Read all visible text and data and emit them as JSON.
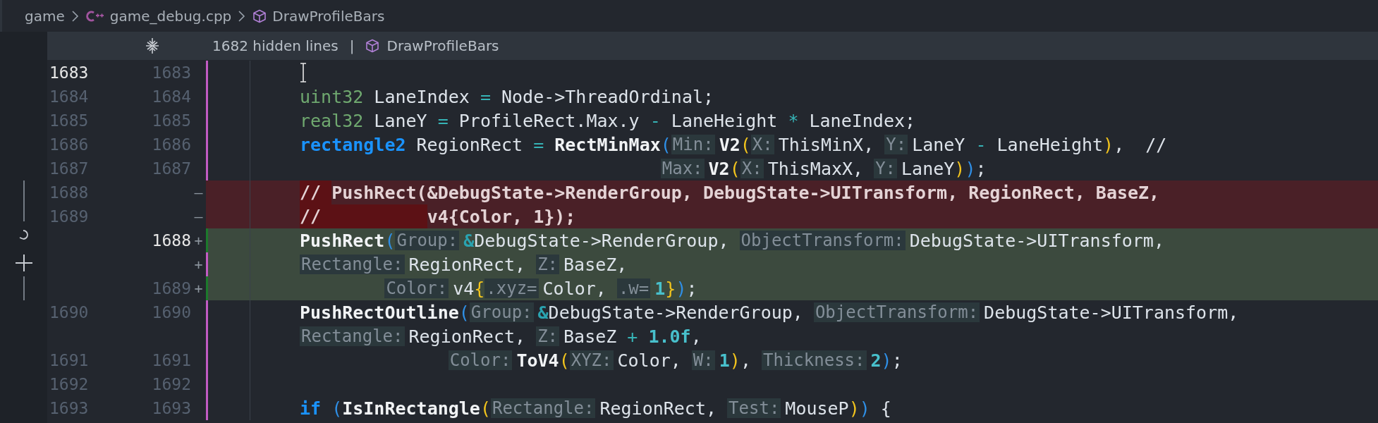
{
  "breadcrumb": [
    {
      "kind": "folder",
      "label": "game"
    },
    {
      "kind": "cpp-file",
      "label": "game_debug.cpp"
    },
    {
      "kind": "symbol",
      "label": "DrawProfileBars"
    }
  ],
  "sticky_header": {
    "hidden_lines": "1682 hidden lines",
    "separator": "|",
    "symbol": "DrawProfileBars"
  },
  "lines": [
    {
      "old": "1683",
      "new": "1683",
      "active": true,
      "kind": "unchanged"
    },
    {
      "old": "1684",
      "new": "1684",
      "active": false,
      "kind": "unchanged",
      "tokens": [
        {
          "kind": "type",
          "text": "uint32"
        },
        {
          "kind": "plain",
          "text": " LaneIndex "
        },
        {
          "kind": "op",
          "text": "="
        },
        {
          "kind": "plain",
          "text": " Node->ThreadOrdinal;"
        }
      ]
    },
    {
      "old": "1685",
      "new": "1685",
      "active": false,
      "kind": "unchanged",
      "tokens": [
        {
          "kind": "type",
          "text": "real32"
        },
        {
          "kind": "plain",
          "text": " LaneY "
        },
        {
          "kind": "op",
          "text": "="
        },
        {
          "kind": "plain",
          "text": " ProfileRect.Max.y "
        },
        {
          "kind": "op",
          "text": "-"
        },
        {
          "kind": "plain",
          "text": " LaneHeight "
        },
        {
          "kind": "op",
          "text": "*"
        },
        {
          "kind": "plain",
          "text": " LaneIndex;"
        }
      ]
    },
    {
      "old": "1686",
      "new": "1686",
      "active": false,
      "kind": "unchanged",
      "tokens": [
        {
          "kind": "keyword",
          "text": "rectangle2"
        },
        {
          "kind": "plain",
          "text": " RegionRect "
        },
        {
          "kind": "op",
          "text": "="
        },
        {
          "kind": "function",
          "text": " RectMinMax"
        },
        {
          "kind": "paren1",
          "text": "("
        },
        {
          "kind": "hint",
          "text": "Min:"
        },
        {
          "kind": "function",
          "text": "V2"
        },
        {
          "kind": "paren2",
          "text": "("
        },
        {
          "kind": "hint",
          "text": "X:"
        },
        {
          "kind": "plain",
          "text": "ThisMinX, "
        },
        {
          "kind": "hint",
          "text": "Y:"
        },
        {
          "kind": "plain",
          "text": "LaneY "
        },
        {
          "kind": "op",
          "text": "-"
        },
        {
          "kind": "plain",
          "text": " LaneHeight"
        },
        {
          "kind": "paren2",
          "text": ")"
        },
        {
          "kind": "plain",
          "text": ",  //"
        }
      ]
    },
    {
      "old": "1687",
      "new": "1687",
      "active": false,
      "kind": "unchanged",
      "tokens": [
        {
          "kind": "hint",
          "text": "                                  Max:"
        },
        {
          "kind": "function",
          "text": "V2"
        },
        {
          "kind": "paren2",
          "text": "("
        },
        {
          "kind": "hint",
          "text": "X:"
        },
        {
          "kind": "plain",
          "text": "ThisMaxX, "
        },
        {
          "kind": "hint",
          "text": "Y:"
        },
        {
          "kind": "plain",
          "text": "LaneY"
        },
        {
          "kind": "paren2",
          "text": ")"
        },
        {
          "kind": "paren1",
          "text": ")"
        },
        {
          "kind": "plain",
          "text": ";"
        }
      ]
    },
    {
      "old": "1688",
      "marker": "—",
      "active": false,
      "kind": "removed",
      "tokens": [
        {
          "kind": "deleted",
          "text": "// "
        },
        {
          "kind": "plain",
          "text": "PushRect(&DebugState->RenderGroup, DebugState->UITransform, RegionRect, BaseZ,"
        }
      ]
    },
    {
      "old": "1689",
      "marker": "—",
      "active": false,
      "kind": "removed",
      "tokens": [
        {
          "kind": "deleted",
          "text": "//          "
        },
        {
          "kind": "plain",
          "text": "v4{Color, 1});"
        }
      ]
    },
    {
      "new": "1688",
      "marker": "+",
      "active": true,
      "kind": "added",
      "tokens": [
        {
          "kind": "function",
          "text": "PushRect"
        },
        {
          "kind": "paren1",
          "text": "("
        },
        {
          "kind": "hint",
          "text": "Group:"
        },
        {
          "kind": "amp",
          "text": "&"
        },
        {
          "kind": "plain",
          "text": "DebugState->RenderGroup, "
        },
        {
          "kind": "hint",
          "text": "ObjectTransform:"
        },
        {
          "kind": "plain",
          "text": "DebugState->UITransform,"
        }
      ]
    },
    {
      "marker": "+",
      "kind": "added",
      "tokens": [
        {
          "kind": "hint",
          "text": "Rectangle:"
        },
        {
          "kind": "plain",
          "text": "RegionRect, "
        },
        {
          "kind": "hint",
          "text": "Z:"
        },
        {
          "kind": "plain",
          "text": "BaseZ,"
        }
      ]
    },
    {
      "new": "1689",
      "marker": "+",
      "active": false,
      "kind": "added",
      "tokens": [
        {
          "kind": "hint",
          "text": "        Color:"
        },
        {
          "kind": "plain",
          "text": "v4"
        },
        {
          "kind": "paren2",
          "text": "{"
        },
        {
          "kind": "hint",
          "text": ".xyz="
        },
        {
          "kind": "plain",
          "text": "Color, "
        },
        {
          "kind": "hint",
          "text": ".w="
        },
        {
          "kind": "number",
          "text": "1"
        },
        {
          "kind": "paren2",
          "text": "}"
        },
        {
          "kind": "paren1",
          "text": ")"
        },
        {
          "kind": "plain",
          "text": ";"
        }
      ]
    },
    {
      "old": "1690",
      "new": "1690",
      "active": false,
      "kind": "unchanged",
      "tokens": [
        {
          "kind": "function",
          "text": "PushRectOutline"
        },
        {
          "kind": "paren1",
          "text": "("
        },
        {
          "kind": "hint",
          "text": "Group:"
        },
        {
          "kind": "amp",
          "text": "&"
        },
        {
          "kind": "plain",
          "text": "DebugState->RenderGroup, "
        },
        {
          "kind": "hint",
          "text": "ObjectTransform:"
        },
        {
          "kind": "plain",
          "text": "DebugState->UITransform,"
        }
      ]
    },
    {
      "kind": "unchanged",
      "tokens": [
        {
          "kind": "hint",
          "text": "Rectangle:"
        },
        {
          "kind": "plain",
          "text": "RegionRect, "
        },
        {
          "kind": "hint",
          "text": "Z:"
        },
        {
          "kind": "plain",
          "text": "BaseZ "
        },
        {
          "kind": "op",
          "text": "+"
        },
        {
          "kind": "number",
          "text": " 1.0f"
        },
        {
          "kind": "plain",
          "text": ","
        }
      ]
    },
    {
      "old": "1691",
      "new": "1691",
      "active": false,
      "kind": "unchanged",
      "tokens": [
        {
          "kind": "hint",
          "text": "              Color:"
        },
        {
          "kind": "function",
          "text": "ToV4"
        },
        {
          "kind": "paren2",
          "text": "("
        },
        {
          "kind": "hint",
          "text": "XYZ:"
        },
        {
          "kind": "plain",
          "text": "Color, "
        },
        {
          "kind": "hint",
          "text": "W:"
        },
        {
          "kind": "number",
          "text": "1"
        },
        {
          "kind": "paren2",
          "text": ")"
        },
        {
          "kind": "plain",
          "text": ", "
        },
        {
          "kind": "hint",
          "text": "Thickness:"
        },
        {
          "kind": "number",
          "text": "2"
        },
        {
          "kind": "paren1",
          "text": ")"
        },
        {
          "kind": "plain",
          "text": ";"
        }
      ]
    },
    {
      "old": "1692",
      "new": "1692",
      "active": false,
      "kind": "unchanged"
    },
    {
      "old": "1693",
      "new": "1693",
      "active": false,
      "kind": "unchanged",
      "tokens": [
        {
          "kind": "keyword",
          "text": "if"
        },
        {
          "kind": "paren1",
          "text": " ("
        },
        {
          "kind": "function",
          "text": "IsInRectangle"
        },
        {
          "kind": "paren2",
          "text": "("
        },
        {
          "kind": "hint",
          "text": "Rectangle:"
        },
        {
          "kind": "plain",
          "text": "RegionRect, "
        },
        {
          "kind": "hint",
          "text": "Test:"
        },
        {
          "kind": "plain",
          "text": "MouseP"
        },
        {
          "kind": "paren2",
          "text": ")"
        },
        {
          "kind": "paren1",
          "text": ")"
        },
        {
          "kind": "plain",
          "text": " {"
        }
      ]
    }
  ]
}
